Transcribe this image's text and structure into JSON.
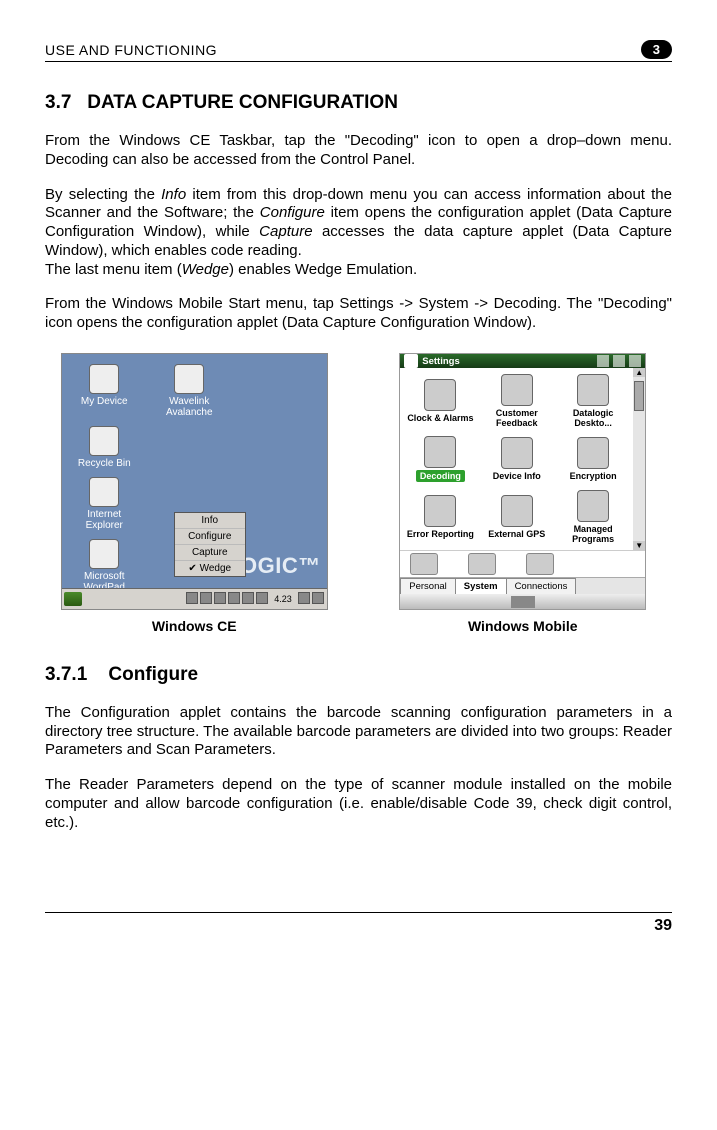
{
  "header": {
    "title": "USE AND FUNCTIONING",
    "badge": "3"
  },
  "section": {
    "number": "3.7",
    "title": "DATA CAPTURE CONFIGURATION"
  },
  "para1": "From the Windows CE Taskbar, tap the \"Decoding\" icon to open a drop–down menu. Decoding can also be accessed from the Control Panel.",
  "para2_pre": "By selecting the ",
  "para2_i1": "Info",
  "para2_mid1": " item from this drop-down menu you can access information about the Scanner and the Software; the ",
  "para2_i2": "Configure",
  "para2_mid2": " item opens the configuration applet (Data Capture Configuration Window), while ",
  "para2_i3": "Capture",
  "para2_mid3": " accesses the data capture applet (Data Capture Window), which enables code reading.",
  "para3_pre": "The last menu item (",
  "para3_i": "Wedge",
  "para3_post": ") enables Wedge Emulation.",
  "para4": "From the Windows Mobile Start menu, tap Settings -> System -> Decoding. The \"Decoding\" icon opens the configuration applet (Data Capture Configuration Window).",
  "ce": {
    "caption": "Windows CE",
    "icons": [
      "My Device",
      "Wavelink Avalanche",
      "Recycle Bin",
      "",
      "Internet Explorer",
      "",
      "Microsoft WordPad",
      ""
    ],
    "menu": [
      "Info",
      "Configure",
      "Capture",
      "Wedge"
    ],
    "menu_checked": "Wedge",
    "brand": "LOGIC™",
    "clock": "4.23"
  },
  "wm": {
    "caption": "Windows Mobile",
    "title": "Settings",
    "items": [
      {
        "label": "Clock & Alarms"
      },
      {
        "label": "Customer Feedback"
      },
      {
        "label": "Datalogic Deskto..."
      },
      {
        "label": "Decoding",
        "selected": true
      },
      {
        "label": "Device Info"
      },
      {
        "label": "Encryption"
      },
      {
        "label": "Error Reporting"
      },
      {
        "label": "External GPS"
      },
      {
        "label": "Managed Programs"
      }
    ],
    "tabs": [
      "Personal",
      "System",
      "Connections"
    ],
    "active_tab": "System"
  },
  "sub": {
    "number": "3.7.1",
    "title": "Configure"
  },
  "sub_p1": "The Configuration applet contains the barcode scanning configuration parameters in a directory tree structure. The available barcode parameters are divided into two groups: Reader Parameters and Scan Parameters.",
  "sub_p2": "The Reader Parameters depend on the type of scanner module installed on the mobile computer and allow barcode configuration (i.e. enable/disable Code 39, check digit control, etc.).",
  "page_number": "39"
}
